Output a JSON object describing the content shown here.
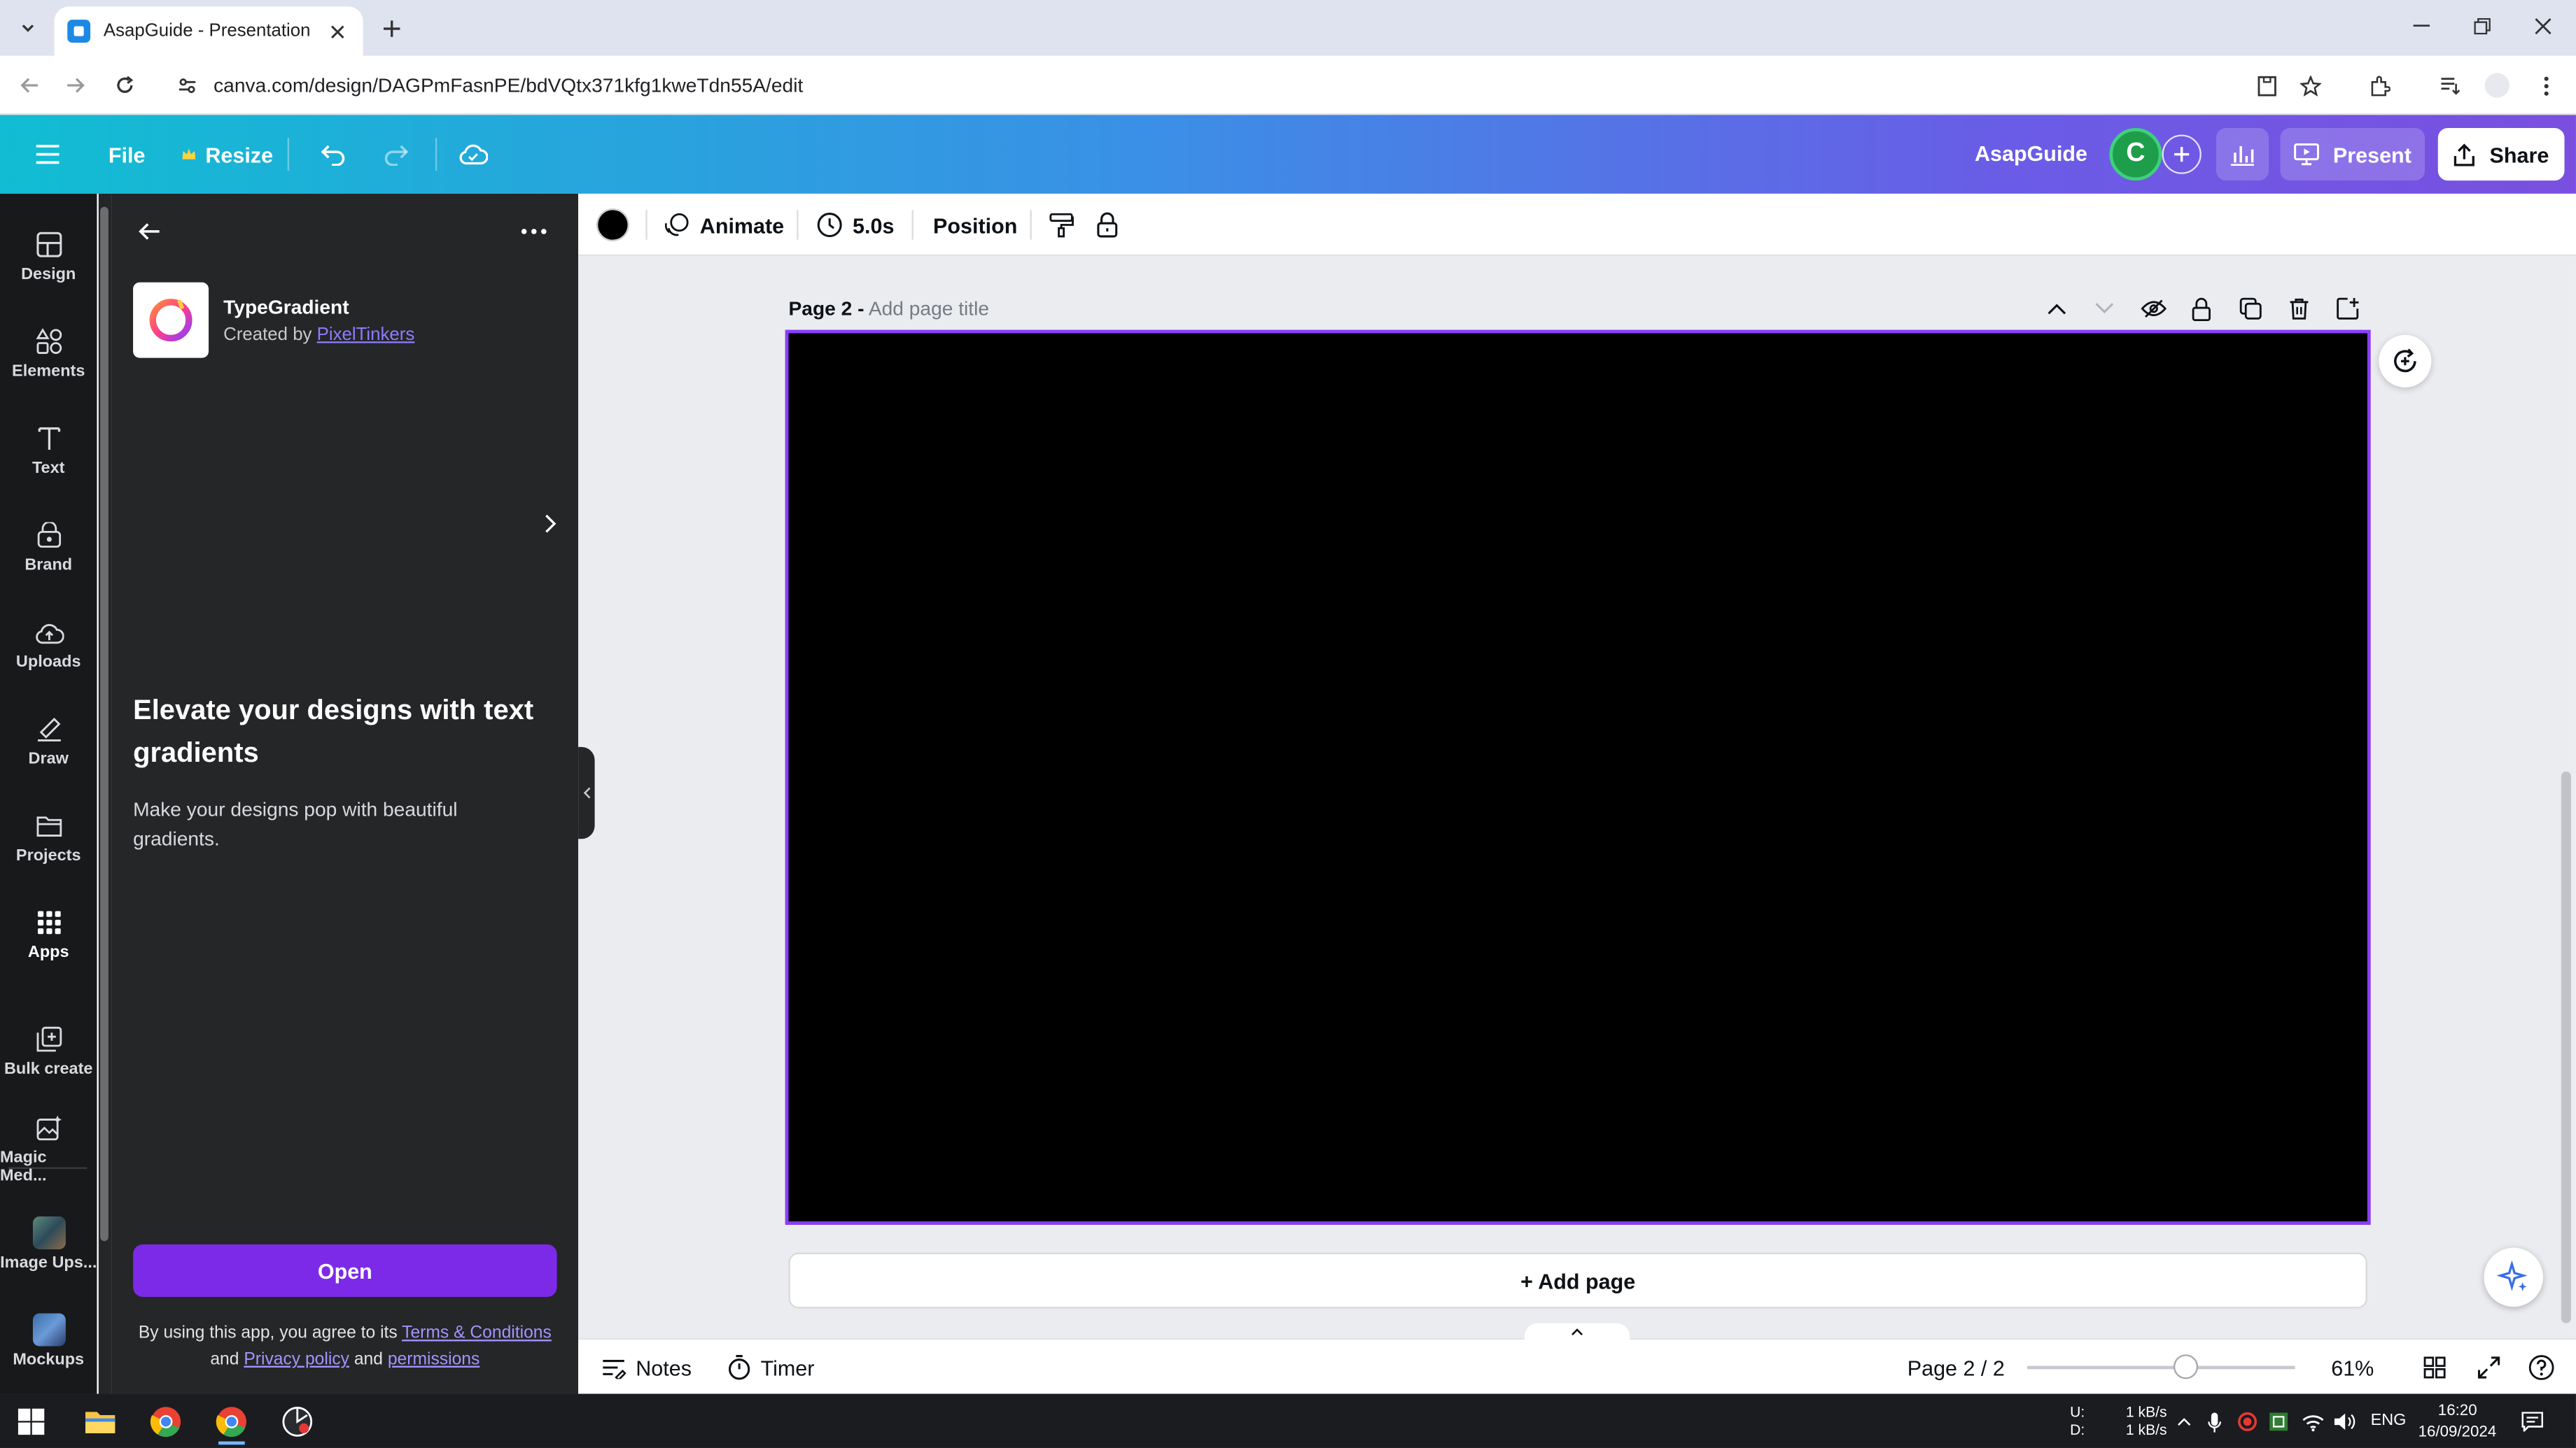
{
  "browser": {
    "tab_title": "AsapGuide - Presentation",
    "url": "canva.com/design/DAGPmFasnPE/bdVQtx371kfg1kweTdn55A/edit"
  },
  "header": {
    "file_label": "File",
    "resize_label": "Resize",
    "team_name": "AsapGuide",
    "avatar_initial": "C",
    "present_label": "Present",
    "share_label": "Share"
  },
  "rail": {
    "items": [
      {
        "label": "Design",
        "icon": "design-icon"
      },
      {
        "label": "Elements",
        "icon": "elements-icon"
      },
      {
        "label": "Text",
        "icon": "text-icon"
      },
      {
        "label": "Brand",
        "icon": "brand-icon"
      },
      {
        "label": "Uploads",
        "icon": "uploads-icon"
      },
      {
        "label": "Draw",
        "icon": "draw-icon"
      },
      {
        "label": "Projects",
        "icon": "projects-icon"
      },
      {
        "label": "Apps",
        "icon": "apps-icon"
      },
      {
        "label": "Bulk create",
        "icon": "bulk-create-icon"
      },
      {
        "label": "Magic Med...",
        "icon": "magic-media-icon"
      },
      {
        "label": "Image Ups...",
        "icon": "image-upscaler-icon"
      },
      {
        "label": "Mockups",
        "icon": "mockups-icon"
      }
    ]
  },
  "panel": {
    "app_name": "TypeGradient",
    "created_by_prefix": "Created by",
    "creator_name": "PixelTinkers",
    "headline": "Elevate your designs with text gradients",
    "description": "Make your designs pop with beautiful gradients.",
    "open_label": "Open",
    "terms_prefix": "By using this app, you agree to its",
    "terms_link": "Terms & Conditions",
    "terms_and1": "and",
    "privacy_link": "Privacy policy",
    "terms_and2": "and",
    "permissions_link": "permissions"
  },
  "context_toolbar": {
    "animate_label": "Animate",
    "duration_label": "5.0s",
    "position_label": "Position",
    "color_value": "#000000"
  },
  "editor": {
    "page_label": "Page 2 -",
    "page_title_placeholder": "Add page title",
    "add_page_label": "+ Add page"
  },
  "bottom_bar": {
    "notes_label": "Notes",
    "timer_label": "Timer",
    "page_indicator": "Page 2 / 2",
    "zoom_label": "61%",
    "zoom_value": 0.61
  },
  "taskbar": {
    "net_up_label": "U:",
    "net_down_label": "D:",
    "net_up": "1 kB/s",
    "net_down": "1 kB/s",
    "lang": "ENG",
    "time": "16:20",
    "date": "16/09/2024"
  },
  "colors": {
    "accent": "#8b3dff",
    "open_button": "#7d2ae8",
    "avatar": "#1e9e4a",
    "canvas": "#000000"
  }
}
